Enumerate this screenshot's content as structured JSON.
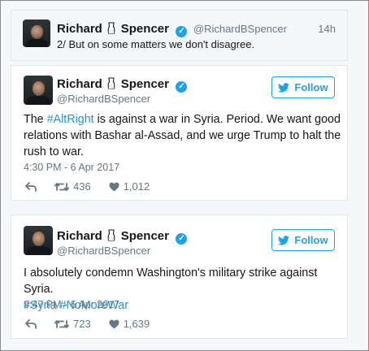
{
  "reply_tweet": {
    "name": "Richard",
    "name_suffix": "Spencer",
    "handle": "@RichardBSpencer",
    "time": "14h",
    "text": "2/ But on some matters we don't disagree."
  },
  "tweet1": {
    "name": "Richard",
    "name_suffix": "Spencer",
    "handle": "@RichardBSpencer",
    "follow_label": "Follow",
    "text_before": "The ",
    "hashtag": "#AltRight",
    "text_line1_rest": " is against a war in Syria. Period. We want good",
    "text_line2": "relations with Bashar al-Assad, and we urge Trump to halt the",
    "text_line3": "rush to war.",
    "timestamp": "4:30 PM - 6 Apr 2017",
    "retweets": "436",
    "likes": "1,012"
  },
  "tweet2": {
    "name": "Richard",
    "name_suffix": "Spencer",
    "handle": "@RichardBSpencer",
    "follow_label": "Follow",
    "text_line1": "I absolutely condemn Washington's military strike against Syria.",
    "hashtags": "#Syria #NoMoreWar",
    "timestamp": "9:47 PM - 6 Apr 2017",
    "retweets": "723",
    "likes": "1,639"
  },
  "colors": {
    "accent": "#1da1f2",
    "link": "#1b95e0",
    "muted": "#657786"
  },
  "icons": [
    "milk-glass-emoji",
    "verified-icon",
    "twitter-bird-icon",
    "reply-icon",
    "retweet-icon",
    "heart-icon"
  ]
}
